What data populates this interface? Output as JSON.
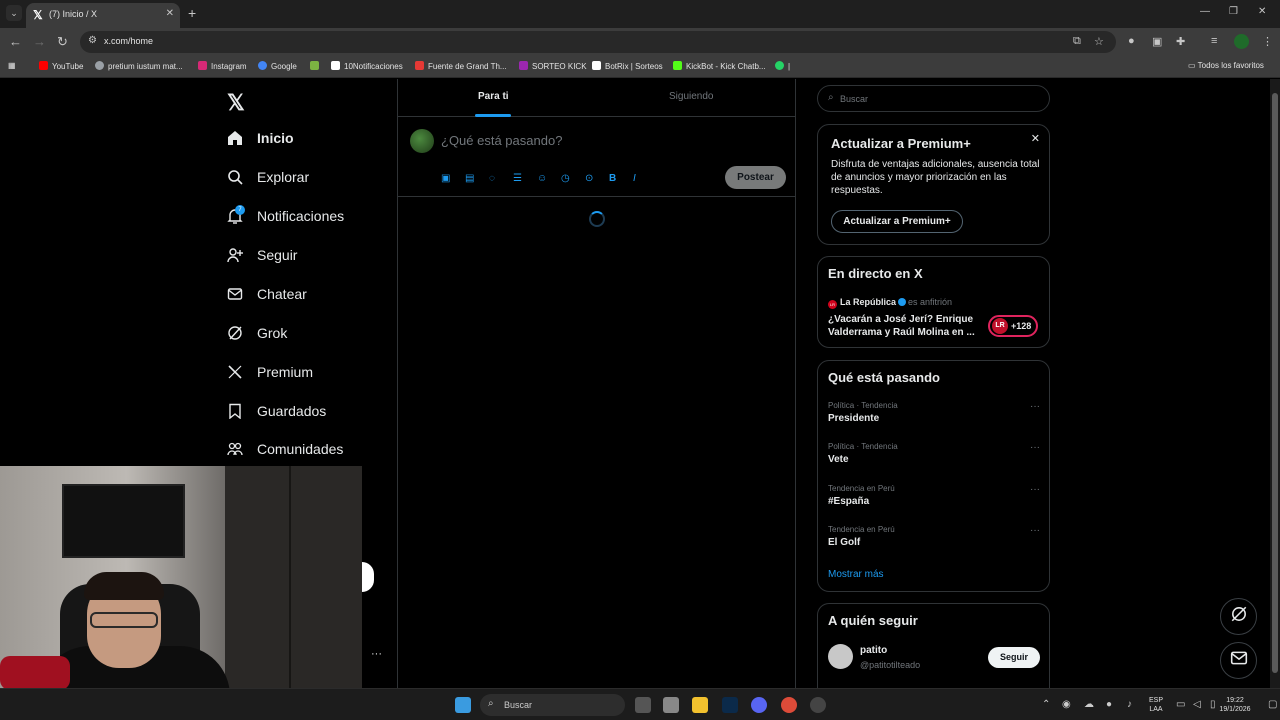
{
  "browser": {
    "tab": {
      "title": "(7) Inicio / X",
      "favicon": "x-logo-icon"
    },
    "url": "x.com/home",
    "bookmarks": [
      {
        "label": "YouTube",
        "color": "#ff0000"
      },
      {
        "label": "pretium iustum mat...",
        "color": "#9aa0a6"
      },
      {
        "label": "Instagram",
        "color": "#d62976"
      },
      {
        "label": "Google",
        "color": "#4285f4"
      },
      {
        "label": "",
        "color": "#7cb342"
      },
      {
        "label": "10Notificaciones",
        "color": "#ffffff"
      },
      {
        "label": "Fuente de Grand Th...",
        "color": "#e53935"
      },
      {
        "label": "SORTEO KICK",
        "color": "#9c27b0"
      },
      {
        "label": "BotRix | Sorteos",
        "color": "#ffffff"
      },
      {
        "label": "KickBot - Kick Chatb...",
        "color": "#53fc18"
      },
      {
        "label": "|",
        "color": "#25d366"
      }
    ],
    "all_bookmarks": "Todos los favoritos"
  },
  "nav": {
    "items": [
      {
        "label": "Inicio",
        "icon": "home-icon"
      },
      {
        "label": "Explorar",
        "icon": "search-icon"
      },
      {
        "label": "Notificaciones",
        "icon": "bell-icon"
      },
      {
        "label": "Seguir",
        "icon": "follow-icon"
      },
      {
        "label": "Chatear",
        "icon": "mail-icon"
      },
      {
        "label": "Grok",
        "icon": "grok-icon"
      },
      {
        "label": "Premium",
        "icon": "x-logo-icon"
      },
      {
        "label": "Guardados",
        "icon": "bookmark-icon"
      },
      {
        "label": "Comunidades",
        "icon": "communities-icon"
      }
    ],
    "notif_count": "7"
  },
  "feed": {
    "tabs": [
      "Para ti",
      "Siguiendo"
    ],
    "composer_placeholder": "¿Qué está pasando?",
    "post_label": "Postear"
  },
  "sidebar": {
    "search_placeholder": "Buscar",
    "premium": {
      "title": "Actualizar a Premium+",
      "text": "Disfruta de ventajas adicionales, ausencia total de anuncios y mayor priorización en las respuestas.",
      "button": "Actualizar a Premium+"
    },
    "live": {
      "title": "En directo en X",
      "host": "La República",
      "host_suffix": "es anfitrión",
      "headline": "¿Vacarán a José Jerí? Enrique Valderrama y Raúl Molina en ...",
      "logo": "LR",
      "count": "+128"
    },
    "trends": {
      "title": "Qué está pasando",
      "items": [
        {
          "meta": "Política · Tendencia",
          "name": "Presidente"
        },
        {
          "meta": "Política · Tendencia",
          "name": "Vete"
        },
        {
          "meta": "Tendencia en Perú",
          "name": "#España"
        },
        {
          "meta": "Tendencia en Perú",
          "name": "El Golf"
        }
      ],
      "show_more": "Mostrar más"
    },
    "who_to_follow": {
      "title": "A quién seguir",
      "name": "patito",
      "handle": "@patitotilteado",
      "button": "Seguir"
    }
  },
  "taskbar": {
    "search_label": "Buscar",
    "lang": "ESP",
    "layout": "LAA",
    "time": "19:22",
    "date": "19/1/2026"
  }
}
